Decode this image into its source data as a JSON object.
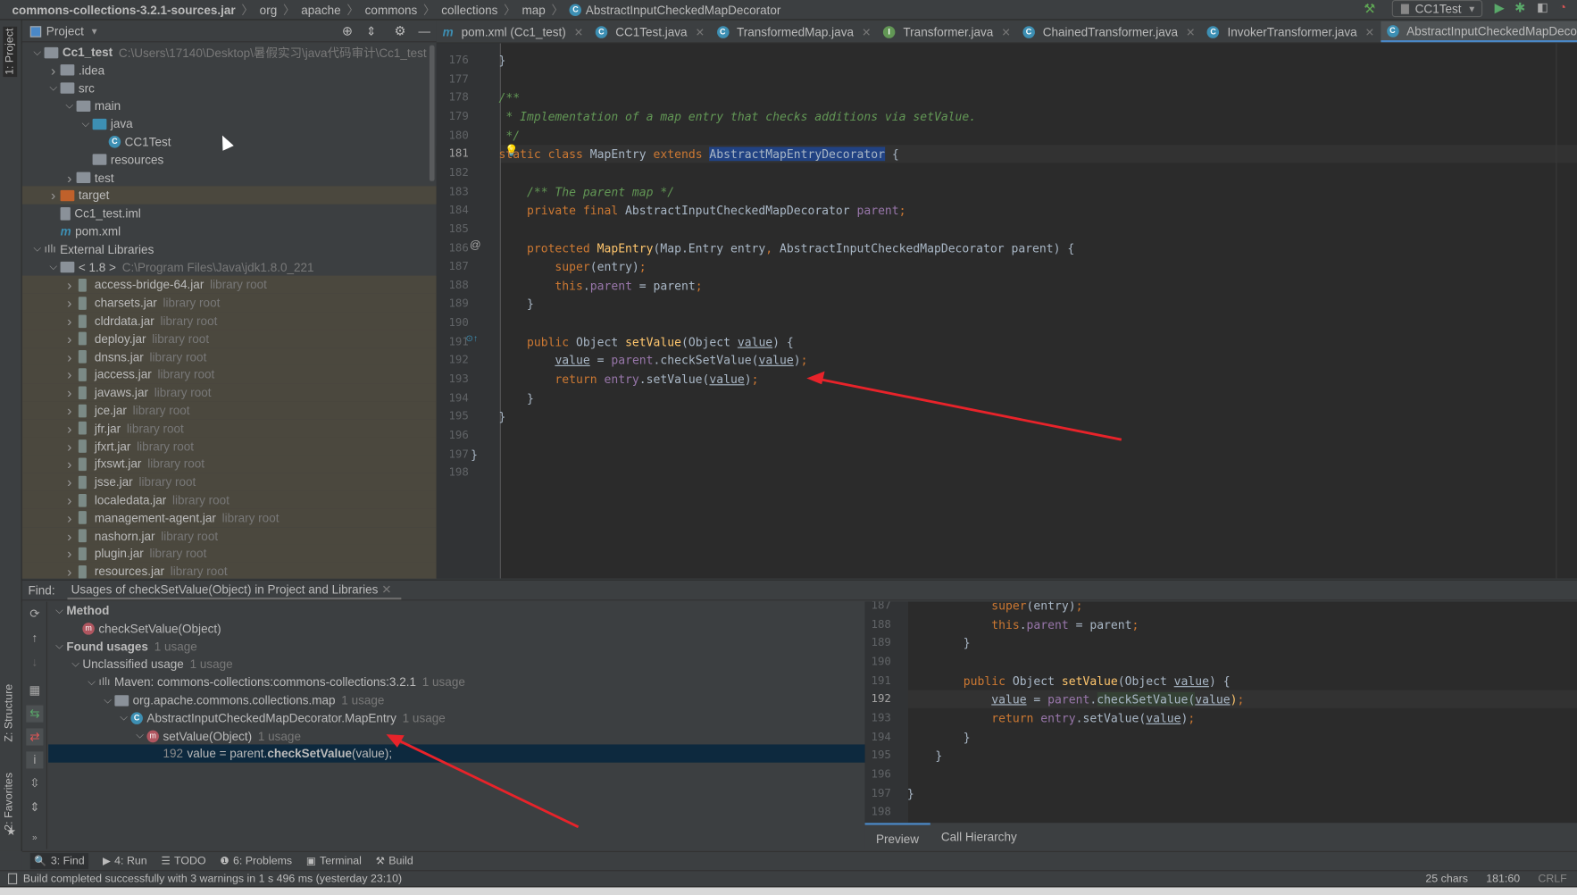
{
  "navbar": {
    "crumbs": [
      "commons-collections-3.2.1-sources.jar",
      "org",
      "apache",
      "commons",
      "collections",
      "map",
      "AbstractInputCheckedMapDecorator"
    ]
  },
  "toolbar": {
    "run_config": "CC1Test",
    "hammer_icon": "hammer-icon",
    "run_icon": "run-icon",
    "debug_icon": "debug-icon"
  },
  "left_stripe": {
    "project": "1: Project",
    "structure": "Z: Structure",
    "favorites": "2: Favorites"
  },
  "project": {
    "title": "Project",
    "tree": [
      {
        "label": "Cc1_test",
        "sec": "C:\\Users\\17140\\Desktop\\暑假实习\\java代码审计\\Cc1_test",
        "lvl": 0,
        "arrow": "down",
        "icon": "module",
        "bold": true
      },
      {
        "label": ".idea",
        "lvl": 1,
        "arrow": "right",
        "icon": "folder"
      },
      {
        "label": "src",
        "lvl": 1,
        "arrow": "down",
        "icon": "folder"
      },
      {
        "label": "main",
        "lvl": 2,
        "arrow": "down",
        "icon": "folder"
      },
      {
        "label": "java",
        "lvl": 3,
        "arrow": "down",
        "icon": "source-folder"
      },
      {
        "label": "CC1Test",
        "lvl": 4,
        "arrow": "",
        "icon": "class"
      },
      {
        "label": "resources",
        "lvl": 3,
        "arrow": "",
        "icon": "resource-folder"
      },
      {
        "label": "test",
        "lvl": 2,
        "arrow": "right",
        "icon": "folder"
      },
      {
        "label": "target",
        "lvl": 1,
        "arrow": "right",
        "icon": "excluded-folder",
        "lib": true
      },
      {
        "label": "Cc1_test.iml",
        "lvl": 1,
        "arrow": "",
        "icon": "file"
      },
      {
        "label": "pom.xml",
        "lvl": 1,
        "arrow": "",
        "icon": "maven"
      },
      {
        "label": "External Libraries",
        "lvl": 0,
        "arrow": "down",
        "icon": "libraries"
      },
      {
        "label": "< 1.8 >",
        "sec": "C:\\Program Files\\Java\\jdk1.8.0_221",
        "lvl": 1,
        "arrow": "down",
        "icon": "jdk"
      },
      {
        "label": "access-bridge-64.jar",
        "sec": "library root",
        "lvl": 2,
        "arrow": "right",
        "icon": "jar",
        "lib": true
      },
      {
        "label": "charsets.jar",
        "sec": "library root",
        "lvl": 2,
        "arrow": "right",
        "icon": "jar",
        "lib": true
      },
      {
        "label": "cldrdata.jar",
        "sec": "library root",
        "lvl": 2,
        "arrow": "right",
        "icon": "jar",
        "lib": true
      },
      {
        "label": "deploy.jar",
        "sec": "library root",
        "lvl": 2,
        "arrow": "right",
        "icon": "jar",
        "lib": true
      },
      {
        "label": "dnsns.jar",
        "sec": "library root",
        "lvl": 2,
        "arrow": "right",
        "icon": "jar",
        "lib": true
      },
      {
        "label": "jaccess.jar",
        "sec": "library root",
        "lvl": 2,
        "arrow": "right",
        "icon": "jar",
        "lib": true
      },
      {
        "label": "javaws.jar",
        "sec": "library root",
        "lvl": 2,
        "arrow": "right",
        "icon": "jar",
        "lib": true
      },
      {
        "label": "jce.jar",
        "sec": "library root",
        "lvl": 2,
        "arrow": "right",
        "icon": "jar",
        "lib": true
      },
      {
        "label": "jfr.jar",
        "sec": "library root",
        "lvl": 2,
        "arrow": "right",
        "icon": "jar",
        "lib": true
      },
      {
        "label": "jfxrt.jar",
        "sec": "library root",
        "lvl": 2,
        "arrow": "right",
        "icon": "jar",
        "lib": true
      },
      {
        "label": "jfxswt.jar",
        "sec": "library root",
        "lvl": 2,
        "arrow": "right",
        "icon": "jar",
        "lib": true
      },
      {
        "label": "jsse.jar",
        "sec": "library root",
        "lvl": 2,
        "arrow": "right",
        "icon": "jar",
        "lib": true
      },
      {
        "label": "localedata.jar",
        "sec": "library root",
        "lvl": 2,
        "arrow": "right",
        "icon": "jar",
        "lib": true
      },
      {
        "label": "management-agent.jar",
        "sec": "library root",
        "lvl": 2,
        "arrow": "right",
        "icon": "jar",
        "lib": true
      },
      {
        "label": "nashorn.jar",
        "sec": "library root",
        "lvl": 2,
        "arrow": "right",
        "icon": "jar",
        "lib": true
      },
      {
        "label": "plugin.jar",
        "sec": "library root",
        "lvl": 2,
        "arrow": "right",
        "icon": "jar",
        "lib": true
      },
      {
        "label": "resources.jar",
        "sec": "library root",
        "lvl": 2,
        "arrow": "right",
        "icon": "jar",
        "lib": true
      }
    ]
  },
  "tabs": [
    {
      "label": "pom.xml (Cc1_test)",
      "icon": "maven"
    },
    {
      "label": "CC1Test.java",
      "icon": "class"
    },
    {
      "label": "TransformedMap.java",
      "icon": "class"
    },
    {
      "label": "Transformer.java",
      "icon": "interface"
    },
    {
      "label": "ChainedTransformer.java",
      "icon": "class"
    },
    {
      "label": "InvokerTransformer.java",
      "icon": "class"
    },
    {
      "label": "AbstractInputCheckedMapDecorator.java",
      "icon": "class",
      "active": true
    }
  ],
  "editor": {
    "current_line": 181,
    "lines": [
      {
        "n": 176,
        "t": [
          [
            "    }",
            "pl"
          ]
        ]
      },
      {
        "n": 177,
        "t": []
      },
      {
        "n": 178,
        "t": [
          [
            "    /**",
            "cm"
          ]
        ]
      },
      {
        "n": 179,
        "t": [
          [
            "     * Implementation of a map entry that checks additions via setValue.",
            "cm"
          ]
        ]
      },
      {
        "n": 180,
        "t": [
          [
            "     */",
            "cm"
          ]
        ]
      },
      {
        "n": 181,
        "t": [
          [
            "    static class ",
            "kw"
          ],
          [
            "MapEntry ",
            "pl"
          ],
          [
            "extends ",
            "kw"
          ],
          [
            "AbstractMapEntryDecorator",
            "sel"
          ],
          [
            " {",
            "pl"
          ]
        ]
      },
      {
        "n": 182,
        "t": []
      },
      {
        "n": 183,
        "t": [
          [
            "        /** The parent map */",
            "cm"
          ]
        ]
      },
      {
        "n": 184,
        "t": [
          [
            "        private final ",
            "kw"
          ],
          [
            "AbstractInputCheckedMapDecorator ",
            "pl"
          ],
          [
            "parent",
            "fd"
          ],
          [
            ";",
            "kw"
          ]
        ]
      },
      {
        "n": 185,
        "t": []
      },
      {
        "n": 186,
        "t": [
          [
            "        protected ",
            "kw"
          ],
          [
            "MapEntry",
            "fn"
          ],
          [
            "(Map.Entry entry",
            "pl"
          ],
          [
            ", ",
            "kw"
          ],
          [
            "AbstractInputCheckedMapDecorator parent) {",
            "pl"
          ]
        ]
      },
      {
        "n": 187,
        "t": [
          [
            "            super",
            "kw"
          ],
          [
            "(entry)",
            "pl"
          ],
          [
            ";",
            "kw"
          ]
        ]
      },
      {
        "n": 188,
        "t": [
          [
            "            this",
            "kw"
          ],
          [
            ".",
            "pl"
          ],
          [
            "parent",
            "fd"
          ],
          [
            " = parent",
            "pl"
          ],
          [
            ";",
            "kw"
          ]
        ]
      },
      {
        "n": 189,
        "t": [
          [
            "        }",
            "pl"
          ]
        ]
      },
      {
        "n": 190,
        "t": []
      },
      {
        "n": 191,
        "t": [
          [
            "        public ",
            "kw"
          ],
          [
            "Object ",
            "pl"
          ],
          [
            "setValue",
            "fn"
          ],
          [
            "(Object ",
            "pl"
          ],
          [
            "value",
            "ul"
          ],
          [
            ") {",
            "pl"
          ]
        ]
      },
      {
        "n": 192,
        "t": [
          [
            "            ",
            "pl"
          ],
          [
            "value",
            "ul"
          ],
          [
            " = ",
            "pl"
          ],
          [
            "parent",
            "fd"
          ],
          [
            ".checkSetValue(",
            "pl"
          ],
          [
            "value",
            "ul"
          ],
          [
            ")",
            "pl"
          ],
          [
            ";",
            "kw"
          ]
        ]
      },
      {
        "n": 193,
        "t": [
          [
            "            return ",
            "kw"
          ],
          [
            "entry",
            "fd"
          ],
          [
            ".setValue(",
            "pl"
          ],
          [
            "value",
            "ul"
          ],
          [
            ")",
            "pl"
          ],
          [
            ";",
            "kw"
          ]
        ]
      },
      {
        "n": 194,
        "t": [
          [
            "        }",
            "pl"
          ]
        ]
      },
      {
        "n": 195,
        "t": [
          [
            "    }",
            "pl"
          ]
        ]
      },
      {
        "n": 196,
        "t": []
      },
      {
        "n": 197,
        "t": [
          [
            "}",
            "pl"
          ]
        ]
      },
      {
        "n": 198,
        "t": []
      }
    ]
  },
  "find": {
    "label": "Find:",
    "tab": "Usages of checkSetValue(Object) in Project and Libraries",
    "tree": [
      {
        "label": "Method",
        "lvl": 0,
        "arrow": "down",
        "bold": true
      },
      {
        "label": "checkSetValue(Object)",
        "lvl": 1,
        "arrow": "",
        "icon": "method"
      },
      {
        "label": "Found usages",
        "sec": "1 usage",
        "lvl": 0,
        "arrow": "down",
        "bold": true
      },
      {
        "label": "Unclassified usage",
        "sec": "1 usage",
        "lvl": 1,
        "arrow": "down"
      },
      {
        "label": "Maven: commons-collections:commons-collections:3.2.1",
        "sec": "1 usage",
        "lvl": 2,
        "arrow": "down",
        "icon": "libraries"
      },
      {
        "label": "org.apache.commons.collections.map",
        "sec": "1 usage",
        "lvl": 3,
        "arrow": "down",
        "icon": "package"
      },
      {
        "label": "AbstractInputCheckedMapDecorator.MapEntry",
        "sec": "1 usage",
        "lvl": 4,
        "arrow": "down",
        "icon": "class"
      },
      {
        "label": "setValue(Object)",
        "sec": "1 usage",
        "lvl": 5,
        "arrow": "down",
        "icon": "method"
      },
      {
        "usage": true,
        "lvl": 6,
        "line": "192",
        "pre": "value = parent.",
        "bold": "checkSetValue",
        "post": "(value);",
        "selected": true
      }
    ]
  },
  "preview": {
    "current_line": 192,
    "lines": [
      {
        "n": 187,
        "t": [
          [
            "            super",
            "kw"
          ],
          [
            "(entry)",
            "pl"
          ],
          [
            ";",
            "kw"
          ]
        ]
      },
      {
        "n": 188,
        "t": [
          [
            "            this",
            "kw"
          ],
          [
            ".",
            "pl"
          ],
          [
            "parent",
            "fd"
          ],
          [
            " = parent",
            "pl"
          ],
          [
            ";",
            "kw"
          ]
        ]
      },
      {
        "n": 189,
        "t": [
          [
            "        }",
            "pl"
          ]
        ]
      },
      {
        "n": 190,
        "t": []
      },
      {
        "n": 191,
        "t": [
          [
            "        public ",
            "kw"
          ],
          [
            "Object ",
            "pl"
          ],
          [
            "setValue",
            "fn"
          ],
          [
            "(Object ",
            "pl"
          ],
          [
            "value",
            "ul"
          ],
          [
            ") {",
            "pl"
          ]
        ]
      },
      {
        "n": 192,
        "t": [
          [
            "            ",
            "pl"
          ],
          [
            "value",
            "ul"
          ],
          [
            " = ",
            "pl"
          ],
          [
            "parent",
            "fd"
          ],
          [
            ".",
            "pl"
          ],
          [
            "checkSetValue(",
            "hl"
          ],
          [
            "value",
            "ul"
          ],
          [
            ")",
            "fn"
          ],
          [
            ";",
            "kw"
          ]
        ]
      },
      {
        "n": 193,
        "t": [
          [
            "            return ",
            "kw"
          ],
          [
            "entry",
            "fd"
          ],
          [
            ".setValue(",
            "pl"
          ],
          [
            "value",
            "ul"
          ],
          [
            ")",
            "pl"
          ],
          [
            ";",
            "kw"
          ]
        ]
      },
      {
        "n": 194,
        "t": [
          [
            "        }",
            "pl"
          ]
        ]
      },
      {
        "n": 195,
        "t": [
          [
            "    }",
            "pl"
          ]
        ]
      },
      {
        "n": 196,
        "t": []
      },
      {
        "n": 197,
        "t": [
          [
            "}",
            "pl"
          ]
        ]
      },
      {
        "n": 198,
        "t": []
      }
    ],
    "tabs": [
      "Preview",
      "Call Hierarchy"
    ]
  },
  "bottom_tabs": [
    {
      "label": "3: Find",
      "icon": "search-icon",
      "active": true
    },
    {
      "label": "4: Run",
      "icon": "run-icon"
    },
    {
      "label": "TODO",
      "icon": "list-icon"
    },
    {
      "label": "6: Problems",
      "icon": "problems-icon"
    },
    {
      "label": "Terminal",
      "icon": "terminal-icon"
    },
    {
      "label": "Build",
      "icon": "hammer-icon"
    }
  ],
  "status": {
    "message": "Build completed successfully with 3 warnings in 1 s 496 ms (yesterday 23:10)",
    "chars": "25 chars",
    "position": "181:60",
    "line_sep": "CRLF"
  },
  "colors": {
    "keyword": "#cc7832",
    "comment": "#629755",
    "method": "#ffc66d",
    "field": "#9876aa",
    "text": "#a9b7c6",
    "selection": "#214283",
    "accent": "#4a88c7",
    "annotation_arrow": "#e8232a"
  }
}
